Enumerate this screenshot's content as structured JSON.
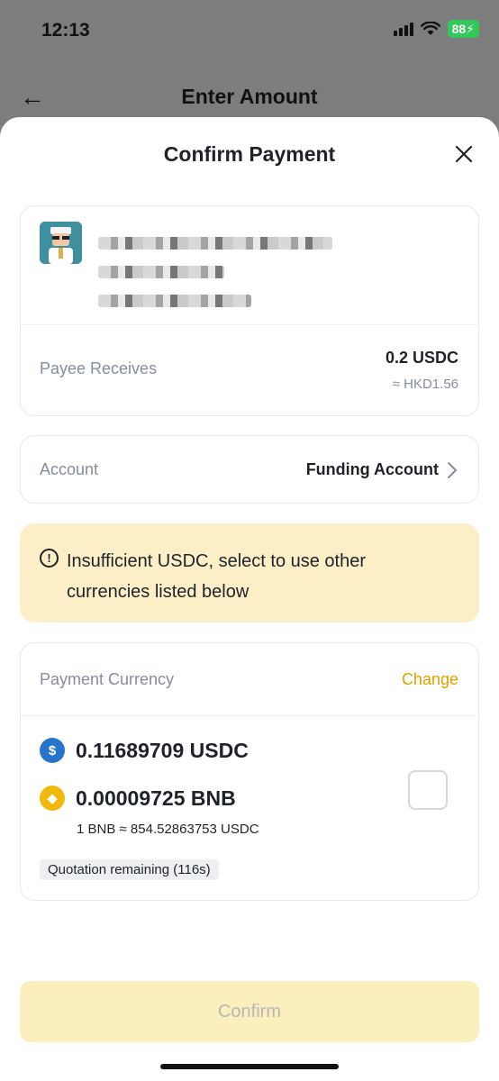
{
  "status_bar": {
    "time": "12:13",
    "battery": "88"
  },
  "background_page": {
    "title": "Enter Amount"
  },
  "sheet": {
    "title": "Confirm Payment"
  },
  "payee": {
    "receives_label": "Payee Receives",
    "amount": "0.2 USDC",
    "fiat_equivalent": "≈ HKD1.56"
  },
  "account": {
    "label": "Account",
    "value": "Funding Account"
  },
  "warning": {
    "text": "Insufficient USDC, select to use other currencies listed below"
  },
  "payment_currency": {
    "label": "Payment Currency",
    "change_label": "Change",
    "coins": [
      {
        "amount": "0.11689709 USDC",
        "symbol": "USDC",
        "icon": "usdc-coin-icon",
        "color": "#2775ca"
      },
      {
        "amount": "0.00009725 BNB",
        "symbol": "BNB",
        "icon": "bnb-coin-icon",
        "color": "#f0b90b"
      }
    ],
    "rate": "1 BNB ≈ 854.52863753 USDC",
    "quotation": "Quotation remaining (116s)"
  },
  "confirm_label": "Confirm",
  "colors": {
    "accent": "#e0a000",
    "warning_bg": "#fcefc7",
    "confirm_disabled_bg": "#fbefbe"
  }
}
